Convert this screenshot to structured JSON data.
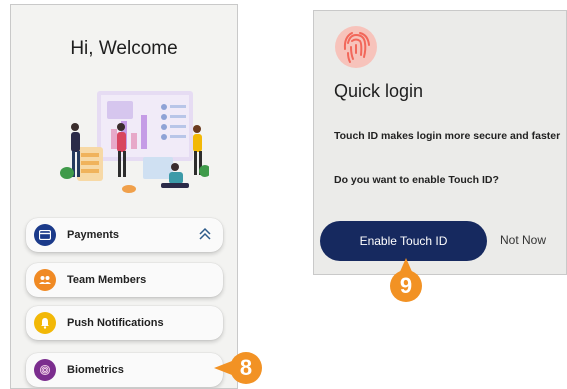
{
  "home": {
    "greeting": "Hi, Welcome",
    "menu": [
      {
        "label": "Payments",
        "icon": "card-icon",
        "color": "#1b3a8a"
      },
      {
        "label": "Team Members",
        "icon": "team-icon",
        "color": "#f08a24"
      },
      {
        "label": "Push Notifications",
        "icon": "bell-icon",
        "color": "#f2b807"
      },
      {
        "label": "Biometrics",
        "icon": "fingerprint-icon",
        "color": "#7b2d8e"
      }
    ]
  },
  "quick_login": {
    "title": "Quick login",
    "description": "Touch ID makes login more secure and faster",
    "question": "Do you want to enable Touch ID?",
    "enable_button": "Enable Touch ID",
    "not_now_button": "Not Now"
  },
  "callouts": {
    "step_8": "8",
    "step_9": "9"
  },
  "colors": {
    "callout": "#f29224",
    "primary_button": "#16295f",
    "fingerprint": "#f2675a"
  }
}
